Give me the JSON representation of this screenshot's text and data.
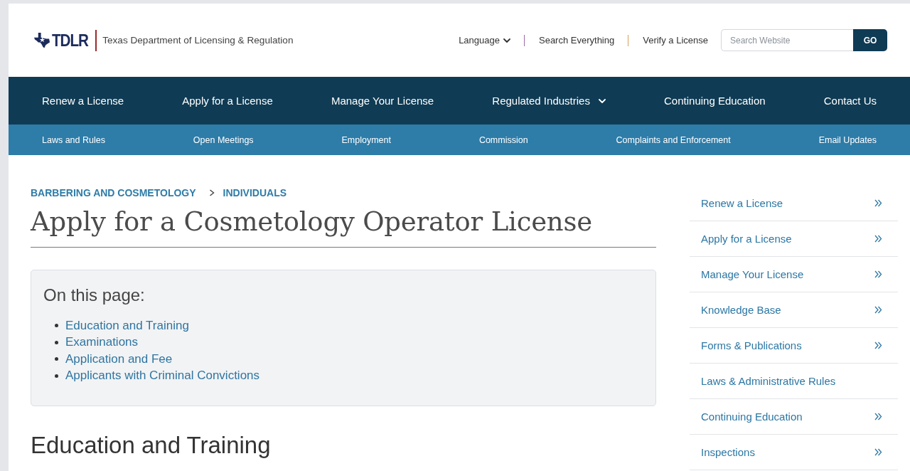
{
  "header": {
    "logo": {
      "wordmark": "TDLR",
      "agency": "Texas Department of Licensing & Regulation"
    },
    "utility_links": [
      {
        "label": "Language",
        "kind": "dropdown"
      },
      {
        "label": "Search Everything",
        "kind": "link"
      },
      {
        "label": "Verify a License",
        "kind": "link"
      }
    ],
    "search": {
      "placeholder": "Search Website",
      "button": "GO"
    }
  },
  "main_nav": [
    {
      "label": "Renew a License",
      "has_dropdown": false
    },
    {
      "label": "Apply for a License",
      "has_dropdown": false
    },
    {
      "label": "Manage Your License",
      "has_dropdown": false
    },
    {
      "label": "Regulated Industries",
      "has_dropdown": true
    },
    {
      "label": "Continuing Education",
      "has_dropdown": false
    },
    {
      "label": "Contact Us",
      "has_dropdown": false
    }
  ],
  "sub_nav": [
    "Laws and Rules",
    "Open Meetings",
    "Employment",
    "Commission",
    "Complaints and Enforcement",
    "Email Updates"
  ],
  "breadcrumb": [
    "BARBERING AND COSMETOLOGY",
    "INDIVIDUALS"
  ],
  "page_title": "Apply for a Cosmetology Operator License",
  "on_this_page": {
    "title": "On this page:",
    "links": [
      "Education and Training",
      "Examinations",
      "Application and Fee",
      "Applicants with Criminal Convictions"
    ]
  },
  "section_heading": "Education and Training",
  "sidebar": {
    "items": [
      {
        "label": "Renew a License",
        "has_submenu": true
      },
      {
        "label": "Apply for a License",
        "has_submenu": true
      },
      {
        "label": "Manage Your License",
        "has_submenu": true
      },
      {
        "label": "Knowledge Base",
        "has_submenu": true
      },
      {
        "label": "Forms & Publications",
        "has_submenu": true
      },
      {
        "label": "Laws & Administrative Rules",
        "has_submenu": false
      },
      {
        "label": "Continuing Education",
        "has_submenu": true
      },
      {
        "label": "Inspections",
        "has_submenu": true
      }
    ]
  }
}
